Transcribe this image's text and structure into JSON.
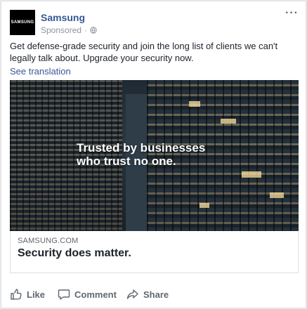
{
  "post": {
    "avatar_text": "SAMSUNG",
    "page_name": "Samsung",
    "sponsored_label": "Sponsored",
    "separator": "·",
    "more_label": "···",
    "body_text": "Get defense-grade security and join the long list of clients we can't legally talk about. Upgrade your security now.",
    "see_translation": "See translation"
  },
  "ad": {
    "headline_line1": "Trusted by businesses",
    "headline_line2": "who trust no one.",
    "domain": "SAMSUNG.COM",
    "title": "Security does matter."
  },
  "actions": {
    "like_label": "Like",
    "comment_label": "Comment",
    "share_label": "Share"
  },
  "icons": [
    "globe-icon",
    "more-icon",
    "like-icon",
    "comment-icon",
    "share-icon"
  ],
  "colors": {
    "link_blue": "#365899",
    "muted_gray": "#90949c",
    "text": "#1d2129"
  }
}
